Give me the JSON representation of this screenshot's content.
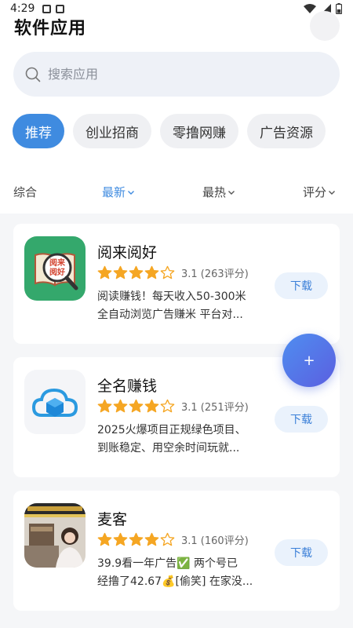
{
  "status_bar": {
    "time": "4:29"
  },
  "header": {
    "title": "软件应用"
  },
  "search": {
    "placeholder": "搜索应用"
  },
  "categories": [
    {
      "label": "推荐",
      "active": true
    },
    {
      "label": "创业招商",
      "active": false
    },
    {
      "label": "零撸网赚",
      "active": false
    },
    {
      "label": "广告资源",
      "active": false
    }
  ],
  "sort": [
    {
      "label": "综合",
      "active": false,
      "has_arrow": false
    },
    {
      "label": "最新",
      "active": true,
      "has_arrow": true
    },
    {
      "label": "最热",
      "active": false,
      "has_arrow": true
    },
    {
      "label": "评分",
      "active": false,
      "has_arrow": true
    }
  ],
  "apps": [
    {
      "name": "阅来阅好",
      "stars": 4,
      "rating_text": "3.1 (263评分)",
      "desc_line1": "阅读赚钱！每天收入50-300米",
      "desc_line2": "全自动浏览广告赚米 平台对...",
      "download_label": "下载",
      "icon": "book-magnifier-icon",
      "icon_text": "阅来阅好"
    },
    {
      "name": "全名赚钱",
      "stars": 4,
      "rating_text": "3.1 (251评分)",
      "desc_line1": "2025火爆项目正规绿色项目、",
      "desc_line2": "到账稳定、用空余时间玩就...",
      "download_label": "下载",
      "icon": "cloud-box-icon"
    },
    {
      "name": "麦客",
      "stars": 4,
      "rating_text": "3.1 (160评分)",
      "desc_line1": "39.9看一年广告✅ 两个号已",
      "desc_line2": "经撸了42.67💰[偷笑] 在家没...",
      "download_label": "下载",
      "icon": "promo-photo-icon"
    }
  ],
  "fab": {
    "label": "+"
  },
  "colors": {
    "accent": "#3f8be0",
    "star": "#f5a623",
    "fab_start": "#4f8ef0",
    "fab_end": "#5b5fe0"
  }
}
